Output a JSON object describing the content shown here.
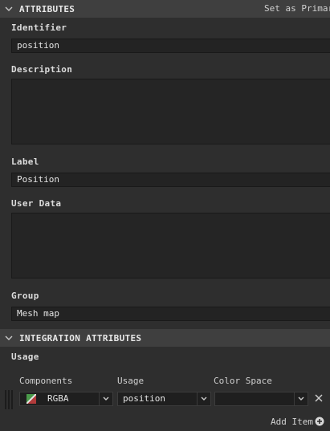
{
  "attributes": {
    "title": "ATTRIBUTES",
    "action_label": "Set as Primary",
    "identifier_label": "Identifier",
    "identifier_value": "position",
    "description_label": "Description",
    "description_value": "",
    "label_label": "Label",
    "label_value": "Position",
    "userdata_label": "User Data",
    "userdata_value": "",
    "group_label": "Group",
    "group_value": "Mesh map"
  },
  "integration": {
    "title": "INTEGRATION ATTRIBUTES",
    "usage_label": "Usage",
    "columns": [
      "Components",
      "Usage",
      "Color Space"
    ],
    "row": {
      "components": "RGBA",
      "usage": "position",
      "color_space": ""
    },
    "add_item_label": "Add Item"
  },
  "colors": {
    "panel_bg": "#2e2e2e",
    "header_bg": "#3f3f3f",
    "field_bg": "#232323"
  },
  "icons": [
    "chevron-down-icon",
    "rgba-swatch-icon",
    "dropdown-arrow-icon",
    "close-icon",
    "add-circle-icon"
  ]
}
